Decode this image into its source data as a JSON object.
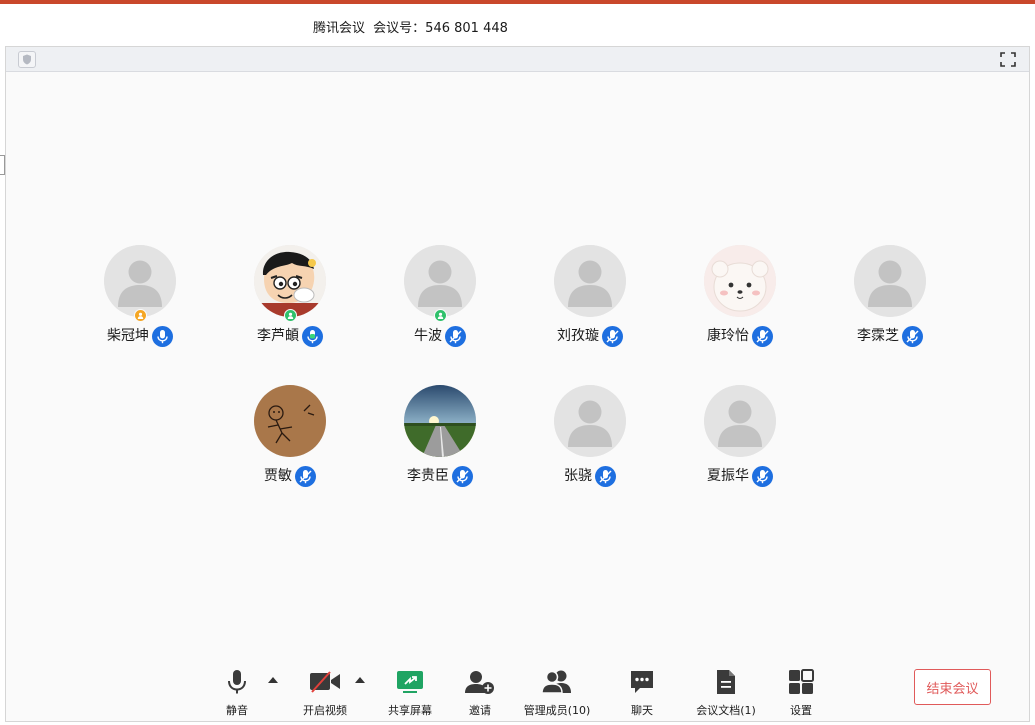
{
  "window": {
    "app_name": "腾讯会议",
    "meeting_id_label": "会议号：",
    "meeting_id": "546 801 448"
  },
  "participants": [
    {
      "name": "柴冠坤",
      "avatar": "default",
      "role": "host"
    },
    {
      "name": "李芦頔",
      "avatar": "cartoon-boy",
      "role": "cohost",
      "speaking": true
    },
    {
      "name": "牛波",
      "avatar": "default",
      "role": "cohost"
    },
    {
      "name": "刘孜璇",
      "avatar": "default"
    },
    {
      "name": "康玲怡",
      "avatar": "white-dog"
    },
    {
      "name": "李霂芝",
      "avatar": "default"
    },
    {
      "name": "贾敏",
      "avatar": "sketch-bear"
    },
    {
      "name": "李贵臣",
      "avatar": "road-sunset"
    },
    {
      "name": "张骁",
      "avatar": "default"
    },
    {
      "name": "夏振华",
      "avatar": "default"
    }
  ],
  "toolbar": {
    "mute": "静音",
    "video": "开启视频",
    "share": "共享屏幕",
    "invite": "邀请",
    "members": "管理成员(10)",
    "chat": "聊天",
    "docs": "会议文档(1)",
    "settings": "设置",
    "end": "结束会议"
  },
  "colors": {
    "accent_top": "#c9482b",
    "mic_blue": "#1e6fe0",
    "host_badge": "#f5a623",
    "cohost_badge": "#2fc16b",
    "share_green": "#1fa463",
    "end_red": "#e05a5a"
  }
}
